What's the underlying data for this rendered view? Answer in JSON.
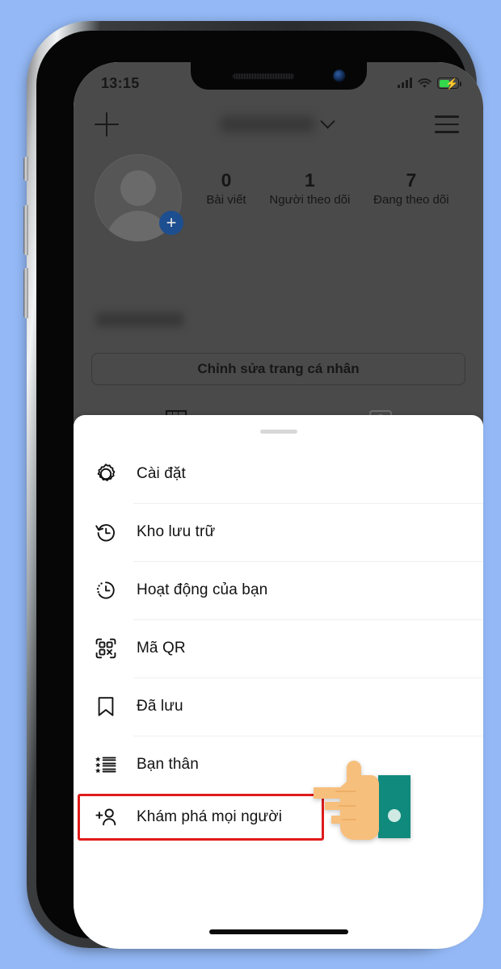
{
  "status_bar": {
    "time": "13:15",
    "signal_icon": "cellular-bars-icon",
    "wifi_icon": "wifi-icon",
    "battery_icon": "battery-charging-icon",
    "battery_color": "#32d74b"
  },
  "profile": {
    "nav": {
      "add_icon": "plus-icon",
      "username": "",
      "chevron_icon": "chevron-down-icon",
      "menu_icon": "hamburger-menu-icon"
    },
    "avatar": {
      "icon": "avatar-placeholder-icon",
      "badge_icon": "plus-badge-icon",
      "badge_color": "#1d4e8f"
    },
    "stats": [
      {
        "value": "0",
        "label": "Bài viết"
      },
      {
        "value": "1",
        "label": "Người theo dõi"
      },
      {
        "value": "7",
        "label": "Đang theo dõi"
      }
    ],
    "edit_button_label": "Chỉnh sửa trang cá nhân",
    "tabs": [
      {
        "name": "grid-tab",
        "icon": "grid-icon",
        "active": true
      },
      {
        "name": "tagged-tab",
        "icon": "tagged-photos-icon",
        "active": false
      }
    ]
  },
  "sheet": {
    "handle": "drag-handle",
    "items": [
      {
        "label": "Cài đặt",
        "icon": "gear-icon",
        "highlighted": false
      },
      {
        "label": "Kho lưu trữ",
        "icon": "archive-clock-icon",
        "highlighted": false
      },
      {
        "label": "Hoạt động của bạn",
        "icon": "activity-clock-icon",
        "highlighted": false
      },
      {
        "label": "Mã QR",
        "icon": "qr-code-icon",
        "highlighted": false
      },
      {
        "label": "Đã lưu",
        "icon": "bookmark-icon",
        "highlighted": false
      },
      {
        "label": "Bạn thân",
        "icon": "close-friends-star-list-icon",
        "highlighted": false
      },
      {
        "label": "Khám phá mọi người",
        "icon": "add-person-icon",
        "highlighted": true
      }
    ],
    "highlight_color": "#e01b1b"
  },
  "annotation": {
    "cursor_icon": "pointing-hand-cursor",
    "skin_color": "#f7bf7c",
    "sleeve_color": "#0f8a7d"
  },
  "home_indicator": "home-indicator-bar"
}
